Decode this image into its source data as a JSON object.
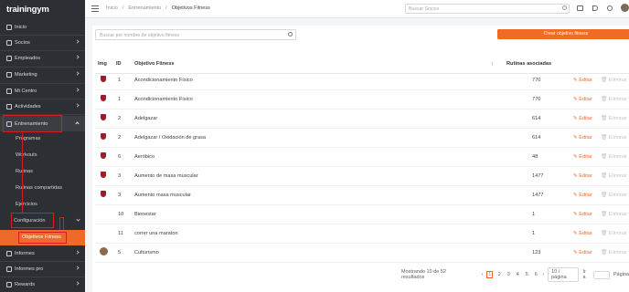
{
  "brand": "trainingym",
  "sidebar": {
    "items": [
      {
        "label": "Inicio"
      },
      {
        "label": "Socios"
      },
      {
        "label": "Empleados"
      },
      {
        "label": "Marketing"
      },
      {
        "label": "Mi Centro"
      },
      {
        "label": "Actividades"
      },
      {
        "label": "Entrenamiento"
      }
    ],
    "sub": [
      {
        "label": "Programas"
      },
      {
        "label": "Workouts"
      },
      {
        "label": "Rutinas"
      },
      {
        "label": "Rutinas compartidas"
      },
      {
        "label": "Ejercicios"
      }
    ],
    "config": "Configuración",
    "config_sub": "Objetivos Fitness",
    "bottom": [
      {
        "label": "Informes"
      },
      {
        "label": "Informes pro"
      },
      {
        "label": "Rewards"
      }
    ]
  },
  "topbar": {
    "breadcrumb": [
      "Inicio",
      "/",
      "Entrenamiento",
      "/",
      "Objetivos Fitness"
    ],
    "search_placeholder": "Buscar Socios"
  },
  "main": {
    "search_placeholder": "Buscar por nombre de objetivo fitness",
    "create_label": "Crear objetivo fitness",
    "columns": [
      "Img",
      "ID",
      "Objetivo Fitness",
      "Rutinas asociadas"
    ],
    "rows": [
      {
        "id": "1",
        "name": "Acondicionamiento Físico",
        "count": "770",
        "img": "shield"
      },
      {
        "id": "1",
        "name": "Acondicionamiento Físico",
        "count": "770",
        "img": "shield"
      },
      {
        "id": "2",
        "name": "Adelgazar",
        "count": "614",
        "img": "shield"
      },
      {
        "id": "2",
        "name": "Adelgazar / Oxidación de grasa",
        "count": "614",
        "img": "shield"
      },
      {
        "id": "6",
        "name": "Aeróbico",
        "count": "48",
        "img": "shield"
      },
      {
        "id": "3",
        "name": "Aumento de masa muscular",
        "count": "1477",
        "img": "shield"
      },
      {
        "id": "3",
        "name": "Aumento masa muscular",
        "count": "1477",
        "img": "shield"
      },
      {
        "id": "10",
        "name": "Bienestar",
        "count": "1",
        "img": ""
      },
      {
        "id": "11",
        "name": "correr una maraton",
        "count": "1",
        "img": ""
      },
      {
        "id": "5",
        "name": "Culturismo",
        "count": "123",
        "img": "avatar"
      }
    ],
    "edit_label": "Editar",
    "delete_label": "Eliminar",
    "pager": {
      "summary": "Mostrando 10 de 52 resultados",
      "pages": [
        "1",
        "2",
        "3",
        "4",
        "5",
        "6"
      ],
      "per_page": "10 / página",
      "goto": "Ir a",
      "page_word": "Página"
    }
  }
}
